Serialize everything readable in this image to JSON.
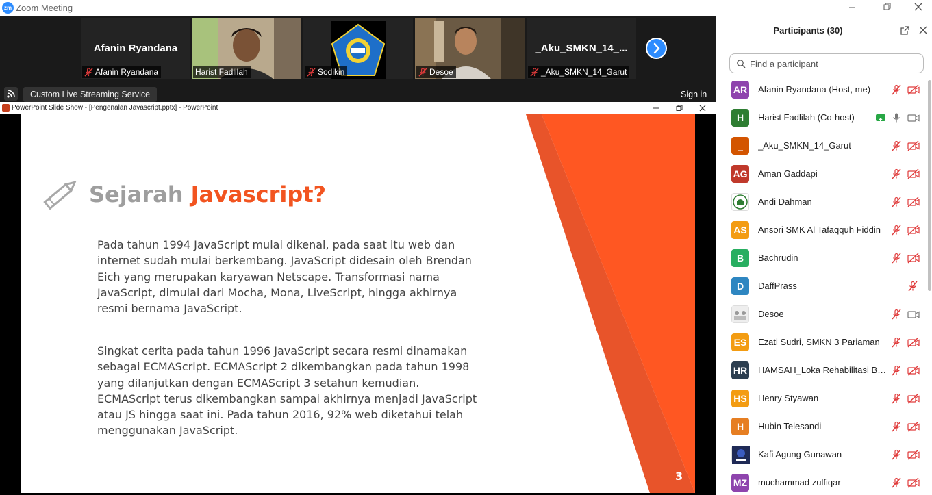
{
  "app": {
    "window_title": "Zoom Meeting",
    "logo_text": "zm"
  },
  "gallery": {
    "tiles": [
      {
        "display_name": "Afanin Ryandana",
        "label": "Afanin Ryandana",
        "muted": true,
        "kind": "name"
      },
      {
        "label": "Harist Fadlilah",
        "muted": false,
        "kind": "video"
      },
      {
        "label": "Sodikin",
        "muted": true,
        "kind": "logo"
      },
      {
        "label": "Desoe",
        "muted": true,
        "kind": "video"
      },
      {
        "display_name": "_Aku_SMKN_14_...",
        "label": "_Aku_SMKN_14_Garut",
        "muted": true,
        "kind": "name"
      }
    ],
    "live_streaming_label": "Custom Live Streaming Service",
    "sign_in_label": "Sign in"
  },
  "powerpoint": {
    "window_title": "PowerPoint Slide Show - [Pengenalan Javascript.pptx] - PowerPoint",
    "slide": {
      "title_part1": "Sejarah ",
      "title_part2": "Javascript?",
      "paragraph1": "Pada tahun 1994 JavaScript mulai dikenal, pada saat itu web dan internet sudah mulai berkembang. JavaScript didesain oleh Brendan Eich yang merupakan karyawan Netscape. Transformasi nama JavaScript, dimulai dari Mocha, Mona, LiveScript, hingga akhirnya resmi bernama JavaScript.",
      "paragraph2": "Singkat cerita pada tahun 1996 JavaScript secara resmi dinamakan sebagai ECMAScript. ECMAScript 2 dikembangkan pada tahun 1998 yang dilanjutkan dengan ECMAScript 3 setahun kemudian. ECMAScript terus dikembangkan sampai akhirnya menjadi JavaScript atau JS hingga saat ini. Pada tahun 2016, 92% web diketahui telah menggunakan JavaScript.",
      "page_number": "3",
      "accent_color": "#f25420"
    }
  },
  "participants": {
    "title": "Participants (30)",
    "search_placeholder": "Find a participant",
    "list": [
      {
        "initials": "AR",
        "name": "Afanin Ryandana (Host, me)",
        "color": "#8e44ad",
        "mic": "off",
        "cam": "off"
      },
      {
        "initials": "H",
        "name": "Harist Fadlilah (Co-host)",
        "color": "#2e7d32",
        "mic": "on",
        "cam": "on",
        "sharing": true
      },
      {
        "initials": "_",
        "name": "_Aku_SMKN_14_Garut",
        "color": "#d35400",
        "mic": "off",
        "cam": "off"
      },
      {
        "initials": "AG",
        "name": "Aman Gaddapi",
        "color": "#c0392b",
        "mic": "off",
        "cam": "off"
      },
      {
        "initials": "",
        "name": "Andi Dahman",
        "color": "#ffffff",
        "mic": "off",
        "cam": "off",
        "image": "mosque-logo"
      },
      {
        "initials": "AS",
        "name": "Ansori SMK Al Tafaqquh Fiddin",
        "color": "#f39c12",
        "mic": "off",
        "cam": "off"
      },
      {
        "initials": "B",
        "name": "Bachrudin",
        "color": "#27ae60",
        "mic": "off",
        "cam": "off"
      },
      {
        "initials": "D",
        "name": "DaffPrass",
        "color": "#2e86c1",
        "mic": "off",
        "cam": "none"
      },
      {
        "initials": "",
        "name": "Desoe",
        "color": "#ffffff",
        "mic": "off",
        "cam": "on",
        "image": "photo-avatar"
      },
      {
        "initials": "ES",
        "name": "Ezati Sudri, SMKN 3 Pariaman",
        "color": "#f39c12",
        "mic": "off",
        "cam": "off"
      },
      {
        "initials": "HR",
        "name": "HAMSAH_Loka Rehabilitasi BN...",
        "color": "#2c3e50",
        "mic": "off",
        "cam": "off"
      },
      {
        "initials": "HS",
        "name": "Henry Styawan",
        "color": "#f39c12",
        "mic": "off",
        "cam": "off"
      },
      {
        "initials": "H",
        "name": "Hubin Telesandi",
        "color": "#e67e22",
        "mic": "off",
        "cam": "off"
      },
      {
        "initials": "",
        "name": "Kafi Agung Gunawan",
        "color": "#1f2a56",
        "mic": "off",
        "cam": "off",
        "image": "kafi-logo"
      },
      {
        "initials": "MZ",
        "name": "muchammad zulfiqar",
        "color": "#8e44ad",
        "mic": "off",
        "cam": "off"
      }
    ]
  }
}
